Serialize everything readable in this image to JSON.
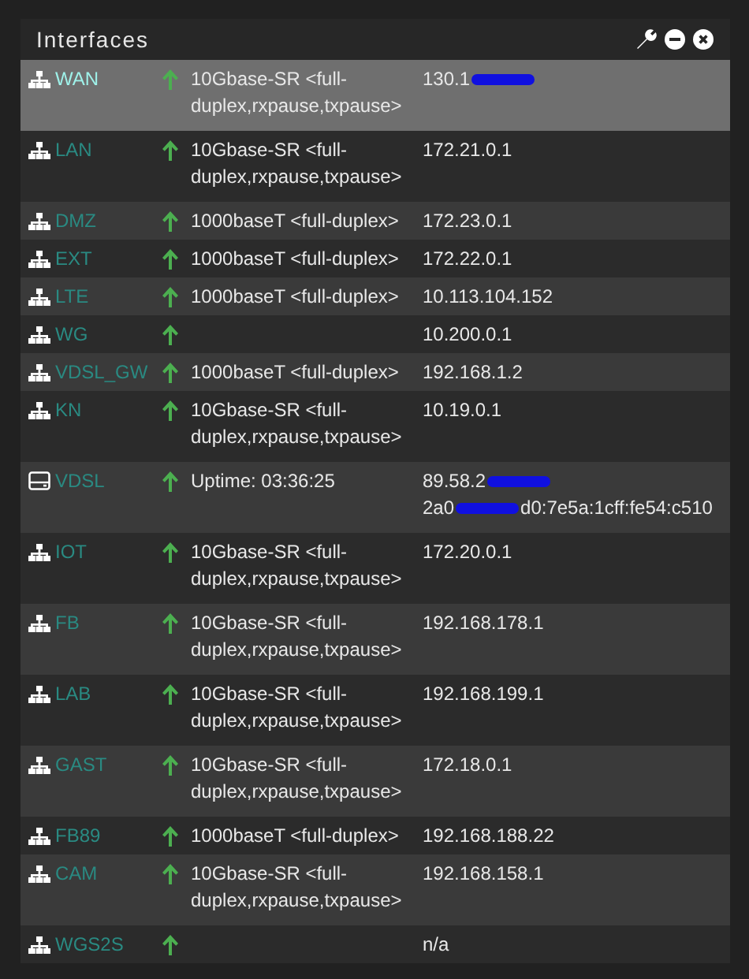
{
  "panel": {
    "title": "Interfaces"
  },
  "rows": [
    {
      "name": "WAN",
      "kind": "network",
      "up": true,
      "selected": true,
      "media": "10Gbase-SR <full-duplex,rxpause,txpause>",
      "address": [
        {
          "kind": "text",
          "text": "130.1"
        },
        {
          "kind": "redacted"
        }
      ]
    },
    {
      "name": "LAN",
      "kind": "network",
      "up": true,
      "selected": false,
      "media": "10Gbase-SR <full-duplex,rxpause,txpause>",
      "address": [
        {
          "kind": "text",
          "text": "172.21.0.1"
        }
      ]
    },
    {
      "name": "DMZ",
      "kind": "network",
      "up": true,
      "selected": false,
      "media": "1000baseT <full-duplex>",
      "address": [
        {
          "kind": "text",
          "text": "172.23.0.1"
        }
      ]
    },
    {
      "name": "EXT",
      "kind": "network",
      "up": true,
      "selected": false,
      "media": "1000baseT <full-duplex>",
      "address": [
        {
          "kind": "text",
          "text": "172.22.0.1"
        }
      ]
    },
    {
      "name": "LTE",
      "kind": "network",
      "up": true,
      "selected": false,
      "media": "1000baseT <full-duplex>",
      "address": [
        {
          "kind": "text",
          "text": "10.113.104.152"
        }
      ]
    },
    {
      "name": "WG",
      "kind": "network",
      "up": true,
      "selected": false,
      "address": [
        {
          "kind": "text",
          "text": "10.200.0.1"
        }
      ]
    },
    {
      "name": "VDSL_GW",
      "kind": "network",
      "up": true,
      "selected": false,
      "media": "1000baseT <full-duplex>",
      "address": [
        {
          "kind": "text",
          "text": "192.168.1.2"
        }
      ]
    },
    {
      "name": "KN",
      "kind": "network",
      "up": true,
      "selected": false,
      "media": "10Gbase-SR <full-duplex,rxpause,txpause>",
      "address": [
        {
          "kind": "text",
          "text": "10.19.0.1"
        }
      ]
    },
    {
      "name": "VDSL",
      "kind": "modem",
      "up": true,
      "selected": false,
      "media": "Uptime: 03:36:25",
      "address": [
        {
          "kind": "text",
          "text": "89.58.2"
        },
        {
          "kind": "redacted"
        },
        {
          "kind": "break"
        },
        {
          "kind": "text",
          "text": "2a0"
        },
        {
          "kind": "redacted"
        },
        {
          "kind": "text",
          "text": "d0:7e5a:1cff:fe54:c510"
        }
      ]
    },
    {
      "name": "IOT",
      "kind": "network",
      "up": true,
      "selected": false,
      "media": "10Gbase-SR <full-duplex,rxpause,txpause>",
      "address": [
        {
          "kind": "text",
          "text": "172.20.0.1"
        }
      ]
    },
    {
      "name": "FB",
      "kind": "network",
      "up": true,
      "selected": false,
      "media": "10Gbase-SR <full-duplex,rxpause,txpause>",
      "address": [
        {
          "kind": "text",
          "text": "192.168.178.1"
        }
      ]
    },
    {
      "name": "LAB",
      "kind": "network",
      "up": true,
      "selected": false,
      "media": "10Gbase-SR <full-duplex,rxpause,txpause>",
      "address": [
        {
          "kind": "text",
          "text": "192.168.199.1"
        }
      ]
    },
    {
      "name": "GAST",
      "kind": "network",
      "up": true,
      "selected": false,
      "media": "10Gbase-SR <full-duplex,rxpause,txpause>",
      "address": [
        {
          "kind": "text",
          "text": "172.18.0.1"
        }
      ]
    },
    {
      "name": "FB89",
      "kind": "network",
      "up": true,
      "selected": false,
      "media": "1000baseT <full-duplex>",
      "address": [
        {
          "kind": "text",
          "text": "192.168.188.22"
        }
      ]
    },
    {
      "name": "CAM",
      "kind": "network",
      "up": true,
      "selected": false,
      "media": "10Gbase-SR <full-duplex,rxpause,txpause>",
      "address": [
        {
          "kind": "text",
          "text": "192.168.158.1"
        }
      ]
    },
    {
      "name": "WGS2S",
      "kind": "network",
      "up": true,
      "selected": false,
      "address": [
        {
          "kind": "text",
          "text": "n/a"
        }
      ]
    }
  ]
}
